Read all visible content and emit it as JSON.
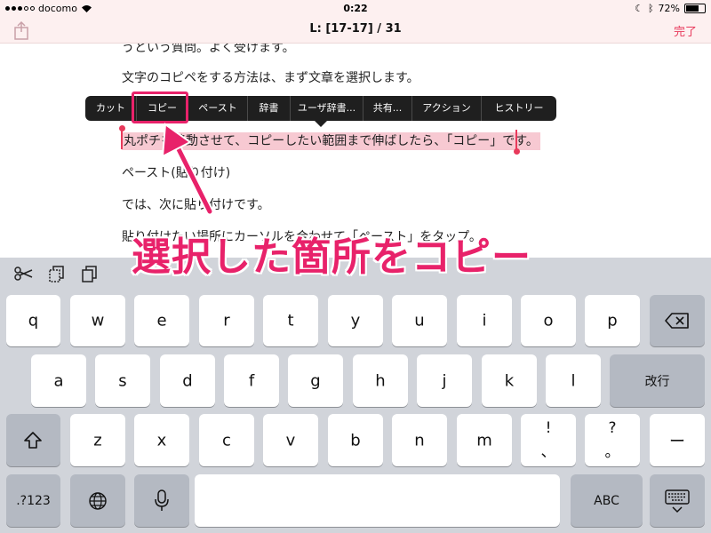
{
  "status_bar": {
    "carrier": "docomo",
    "time": "0:22",
    "battery": "72%",
    "battery_level": 0.72
  },
  "nav": {
    "title": "L: [17-17] / 31",
    "done_label": "完了"
  },
  "document": {
    "lines": [
      "うという質問。よく受けます。",
      "文字のコピペをする方法は、まず文章を選択します。",
      "丸ポチを移動させて、コピーしたい範囲まで伸ばしたら、「コピー」です。",
      "ペースト(貼り付け)",
      "では、次に貼り付けです。",
      "貼り付けたい場所にカーソルを合わせて「ペースト」をタップ。"
    ]
  },
  "edit_menu": {
    "items": [
      "カット",
      "コピー",
      "ペースト",
      "辞書",
      "ユーザ辞書...",
      "共有...",
      "アクション",
      "ヒストリー"
    ]
  },
  "annotation": {
    "text": "選択した箇所をコピー"
  },
  "keyboard": {
    "row1": [
      "q",
      "w",
      "e",
      "r",
      "t",
      "y",
      "u",
      "i",
      "o",
      "p"
    ],
    "row2": [
      "a",
      "s",
      "d",
      "f",
      "g",
      "h",
      "j",
      "k",
      "l"
    ],
    "row3": [
      "z",
      "x",
      "c",
      "v",
      "b",
      "n",
      "m"
    ],
    "punct1_top": "!",
    "punct1_bottom": "、",
    "punct2_top": "?",
    "punct2_bottom": "。",
    "dash": "ー",
    "return_label": "改行",
    "numbers_label": ".?123",
    "abc_label": "ABC",
    "icons": [
      "scissors-icon",
      "copy-icon",
      "paste-icon",
      "delete-icon",
      "shift-icon",
      "globe-icon",
      "microphone-icon",
      "hide-keyboard-icon"
    ]
  },
  "colors": {
    "accent": "#e8395b",
    "selection": "#f7c9d2",
    "annotation": "#e8226a",
    "keyboard_bg": "#d1d4da"
  }
}
